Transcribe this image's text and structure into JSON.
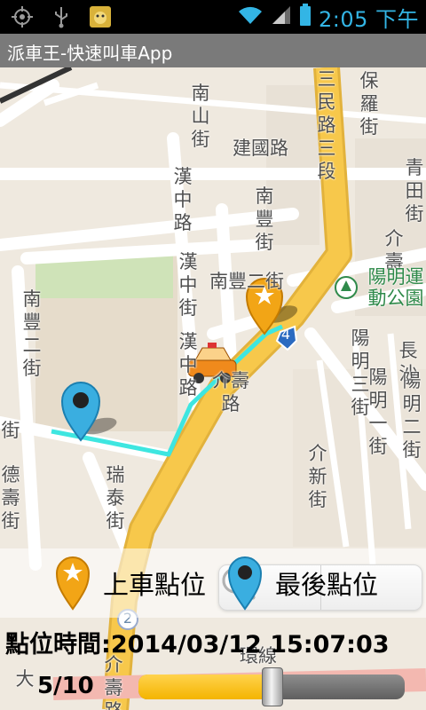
{
  "status_bar": {
    "time": "2:05 下午",
    "icons": [
      "gps-icon",
      "usb-icon",
      "app-notification-icon",
      "wifi-icon",
      "signal-icon",
      "battery-icon"
    ]
  },
  "app": {
    "title": "派車王-快速叫車App"
  },
  "map": {
    "streets": {
      "nanshan": "南山街",
      "jianguo": "建國路",
      "baoluo": "保羅街",
      "sanmin": "三民路三段",
      "qingtian": "青田街",
      "jieshou": "介壽",
      "hanzhong1": "漢中路",
      "hanzhong2": "漢中街",
      "hanzhong3": "漢中路",
      "nanfeng_v": "南豐街",
      "nanfeng2": "南豐二街",
      "nanfeng2_left": "南豐二街",
      "yangming_park": "陽明運動公園",
      "changsha": "長沙",
      "yangming3": "陽明三街",
      "yangming1": "陽明一街",
      "yangming2": "陽明二街",
      "jiexin": "介新街",
      "ruitai": "瑞泰街",
      "jieshou_road": "介壽路",
      "left_jie": "街",
      "deshou": "德壽街",
      "bottom_jieshou": "介壽路",
      "bottom_left": "大",
      "huan": "環線",
      "route_badge": "4",
      "route_badge2": "2"
    },
    "colors": {
      "main_road": "#f7c84b",
      "route_line": "#3ee6e0",
      "background": "#efe9df",
      "park": "#cfe3b8"
    }
  },
  "zoom": {
    "zoom_out": "zoom-out-icon",
    "zoom_in": "zoom-in-icon"
  },
  "legend": {
    "pickup_label": "上車點位",
    "last_label": "最後點位"
  },
  "location_time": {
    "label": "點位時間:",
    "value": "2014/03/12 15:07:03"
  },
  "playback": {
    "counter": "5/10",
    "progress": 0.5
  }
}
